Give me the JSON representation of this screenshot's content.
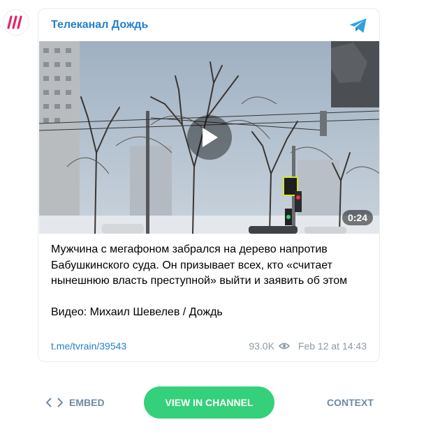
{
  "channel": {
    "name": "Телеканал Дождь",
    "avatar_icon": "dozhd-logo-icon",
    "platform_icon": "telegram-icon"
  },
  "video": {
    "duration": "0:24",
    "play_icon": "play-icon"
  },
  "post": {
    "text": "Мужчина с мегафоном забрался на дерево напротив Бабушкинского суда. Он призывает всех, кто «считает нынешнюю власть преступной» выйти и заявить об этом",
    "caption": "Видео: Михаил Шевелев / Дождь",
    "link": "t.me/tvrain/39543",
    "views": "93.0K",
    "date": "Feb 12 at 14:43"
  },
  "actions": {
    "embed": "EMBED",
    "view_in_channel": "VIEW IN CHANNEL",
    "context": "CONTEXT"
  },
  "colors": {
    "link": "#2481cc",
    "button": "#34d07a",
    "muted": "#8d9aa5",
    "action": "#6c8aa6",
    "brand": "#e5236b"
  }
}
